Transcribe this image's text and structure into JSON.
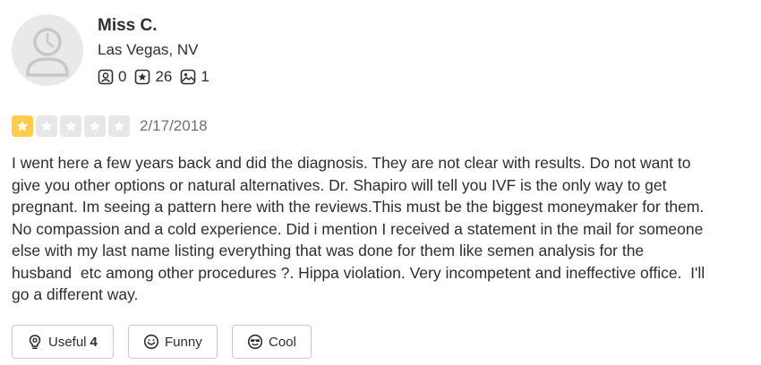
{
  "user": {
    "name": "Miss C.",
    "location": "Las Vegas, NV",
    "stats": {
      "friends": "0",
      "reviews": "26",
      "photos": "1"
    }
  },
  "review": {
    "rating": 1,
    "rating_max": 5,
    "star_color": "#ffcc4b",
    "date": "2/17/2018",
    "text_lines": [
      "I went here a few years back and did the diagnosis. They are not clear with results. Do not want to",
      "give you other options or natural alternatives. Dr. Shapiro will tell you IVF is the only way to get",
      "pregnant. Im seeing a pattern here with the reviews.This must be the biggest moneymaker for them.",
      "No compassion and a cold experience. Did i mention I received a statement in the mail for someone",
      "else with my last name listing everything that was done for them like semen analysis for the",
      "husband  etc among other procedures ?. Hippa violation. Very incompetent and ineffective office.  I'll",
      "go a different way."
    ]
  },
  "actions": {
    "useful": {
      "label": "Useful",
      "count": "4",
      "icon": "lightbulb-icon"
    },
    "funny": {
      "label": "Funny",
      "icon": "smile-icon"
    },
    "cool": {
      "label": "Cool",
      "icon": "sunglasses-icon"
    }
  }
}
